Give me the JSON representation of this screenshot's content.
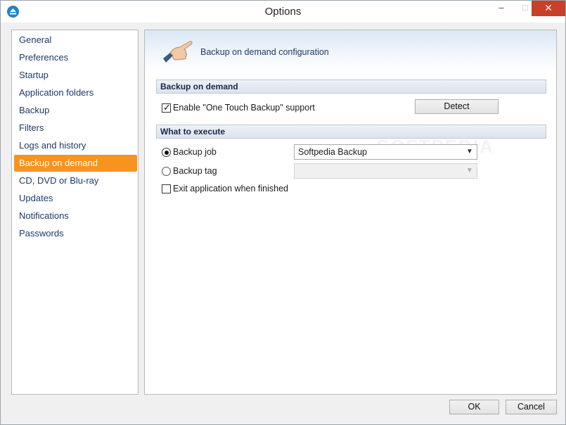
{
  "window": {
    "title": "Options",
    "controls": {
      "minimize": "–",
      "maximize": "□",
      "close": "✕"
    }
  },
  "sidebar": {
    "items": [
      {
        "label": "General"
      },
      {
        "label": "Preferences"
      },
      {
        "label": "Startup"
      },
      {
        "label": "Application folders"
      },
      {
        "label": "Backup"
      },
      {
        "label": "Filters"
      },
      {
        "label": "Logs and history"
      },
      {
        "label": "Backup on demand",
        "active": true
      },
      {
        "label": "CD, DVD or Blu-ray"
      },
      {
        "label": "Updates"
      },
      {
        "label": "Notifications"
      },
      {
        "label": "Passwords"
      }
    ],
    "active_color": "#f7941d"
  },
  "panel": {
    "title": "Backup on demand configuration",
    "icon": "pointing-hand-icon",
    "section_backup": {
      "heading": "Backup on demand",
      "enable_label": "Enable \"One Touch Backup\" support",
      "enable_checked": true,
      "detect_label": "Detect"
    },
    "section_execute": {
      "heading": "What to execute",
      "backup_job_label": "Backup job",
      "backup_job_selected": true,
      "backup_job_value": "Softpedia Backup",
      "backup_tag_label": "Backup tag",
      "backup_tag_selected": false,
      "backup_tag_value": "",
      "exit_label": "Exit application when finished",
      "exit_checked": false
    }
  },
  "footer": {
    "ok_label": "OK",
    "cancel_label": "Cancel"
  },
  "watermark": "SOFTPEDIA"
}
